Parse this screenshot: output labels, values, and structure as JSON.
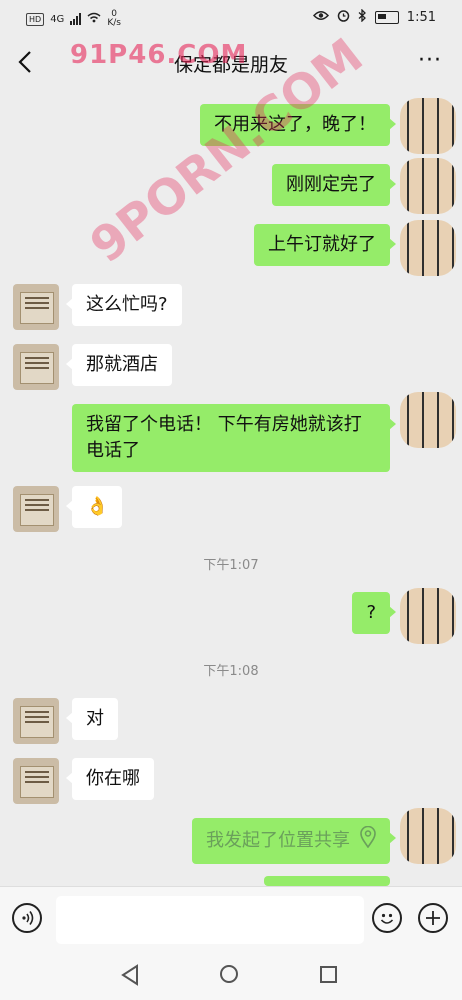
{
  "status": {
    "left_badge": "HD",
    "network": "4G",
    "speed_value": "0",
    "speed_unit": "K/s",
    "time": "1:51"
  },
  "header": {
    "title": "保定都是朋友",
    "more": "···"
  },
  "watermarks": {
    "top": "91P46.COM",
    "diagonal": "9PORN.COM"
  },
  "messages": [
    {
      "side": "me",
      "text": "不用来这了，晚了！"
    },
    {
      "side": "me",
      "text": "刚刚定完了"
    },
    {
      "side": "me",
      "text": "上午订就好了"
    },
    {
      "side": "other",
      "text": "这么忙吗?"
    },
    {
      "side": "other",
      "text": "那就酒店"
    },
    {
      "side": "me",
      "text_line1": "我留了个电话！ 下午有房她就该打",
      "text_line2": "电话了"
    },
    {
      "side": "other",
      "text": "👌"
    },
    {
      "time": "下午1:07"
    },
    {
      "side": "me",
      "text": "?"
    },
    {
      "time": "下午1:08"
    },
    {
      "side": "other",
      "text": "对"
    },
    {
      "side": "other",
      "text": "你在哪"
    },
    {
      "side": "me",
      "text": "我发起了位置共享",
      "type": "location-share"
    }
  ],
  "icons": {
    "back": "chevron-left-icon",
    "more": "more-dots-icon",
    "voice": "voice-icon",
    "emoji": "emoji-icon",
    "plus": "plus-icon",
    "location": "location-pin-icon"
  }
}
